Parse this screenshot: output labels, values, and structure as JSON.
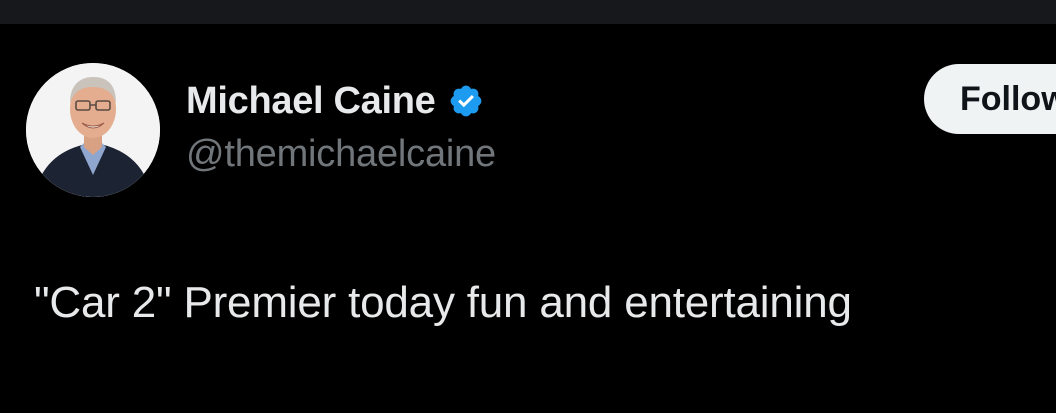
{
  "tweet": {
    "author": {
      "display_name": "Michael Caine",
      "handle": "@themichaelcaine",
      "verified": true,
      "verified_icon": "verified-badge-icon",
      "verified_color": "#1d9bf0",
      "avatar": "profile-photo"
    },
    "follow_label": "Follow",
    "text": "\"Car 2\" Premier today fun and entertaining"
  },
  "colors": {
    "background": "#000000",
    "text_primary": "#e7e9ea",
    "text_secondary": "#71767b",
    "button_bg": "#eff3f4",
    "button_text": "#0f1419"
  }
}
